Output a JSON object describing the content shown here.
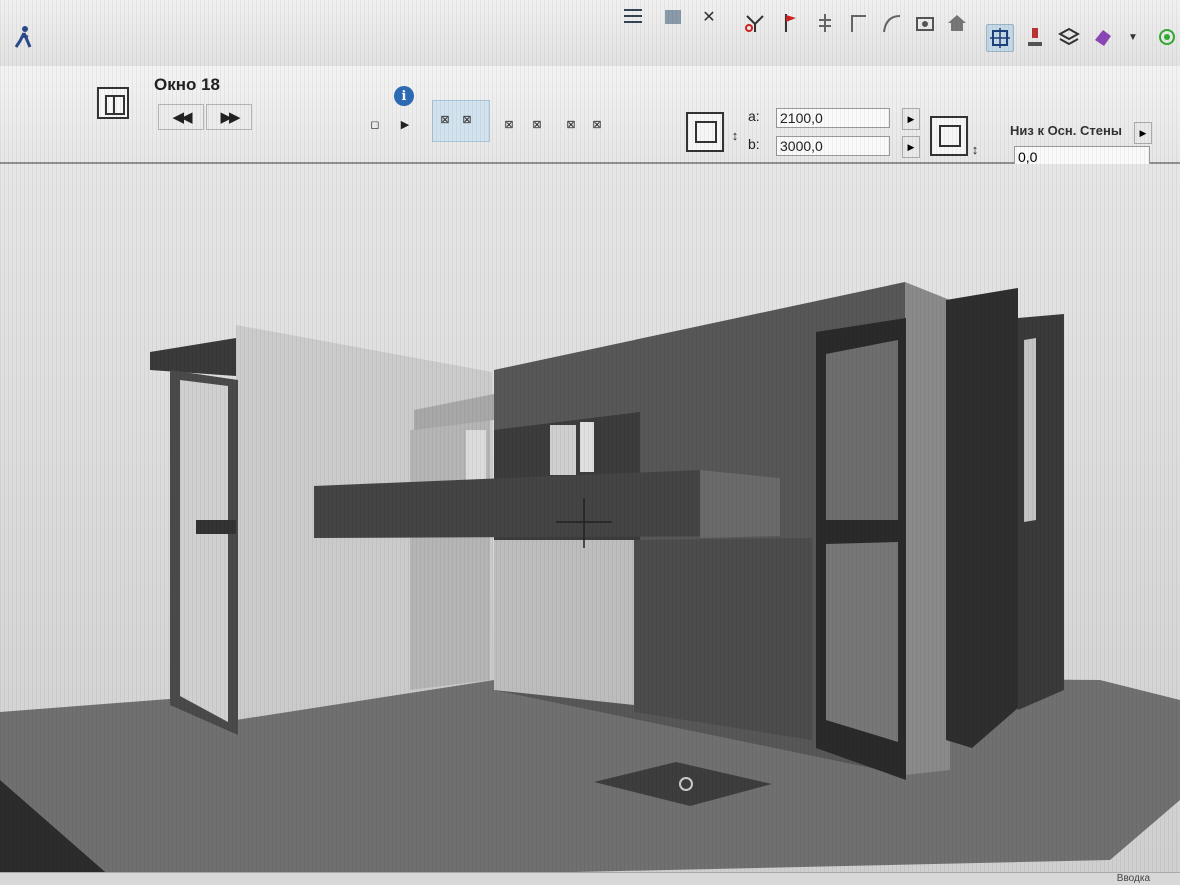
{
  "app": {
    "info_box": {
      "element_title": "Окно 18",
      "prev_label": "◀◀",
      "next_label": "▶▶",
      "info_glyph": "i",
      "width_label": "a:",
      "width_value": "2100,0",
      "height_label": "b:",
      "height_value": "3000,0",
      "sill_label": "Низ к Осн. Стены",
      "sill_value": "0,0",
      "arrow_glyph": "▶"
    },
    "toolbar_icons": [
      "walk-icon",
      "wall-icon",
      "slab-icon",
      "split-icon",
      "flag-icon",
      "level-icon",
      "corner-icon",
      "arc-icon",
      "camera-icon",
      "house-icon",
      "view-icon",
      "paint-icon",
      "layers-icon",
      "render-icon",
      "more-icon"
    ],
    "status": {
      "right_text": "Вводка"
    }
  }
}
